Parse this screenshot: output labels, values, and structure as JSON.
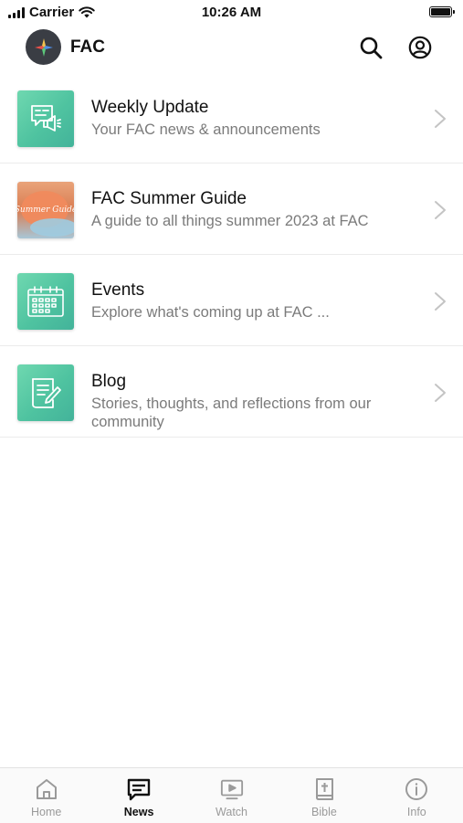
{
  "status_bar": {
    "carrier": "Carrier",
    "time": "10:26 AM"
  },
  "header": {
    "title": "FAC",
    "logo_icon": "fac-logo-icon",
    "actions": [
      "search-icon",
      "account-icon"
    ]
  },
  "news_items": [
    {
      "title": "Weekly Update",
      "subtitle": "Your FAC news & announcements",
      "icon": "megaphone-icon"
    },
    {
      "title": "FAC Summer Guide",
      "subtitle": "A guide to all things summer 2023 at FAC",
      "icon": "summer-guide-thumbnail",
      "thumb_text": "Summer Guide"
    },
    {
      "title": "Events",
      "subtitle": "Explore what's coming up at FAC ...",
      "icon": "calendar-icon"
    },
    {
      "title": "Blog",
      "subtitle": "Stories, thoughts, and reflections from our community",
      "icon": "note-pencil-icon"
    }
  ],
  "tab_bar": {
    "tabs": [
      {
        "label": "Home",
        "icon": "home-icon",
        "active": false
      },
      {
        "label": "News",
        "icon": "news-icon",
        "active": true
      },
      {
        "label": "Watch",
        "icon": "play-screen-icon",
        "active": false
      },
      {
        "label": "Bible",
        "icon": "bible-icon",
        "active": false
      },
      {
        "label": "Info",
        "icon": "info-icon",
        "active": false
      }
    ]
  },
  "colors": {
    "thumb_green": "#4fc3a0",
    "text_primary": "#111111",
    "text_secondary": "#7b7b7b",
    "tab_inactive": "#9a9a9a"
  }
}
